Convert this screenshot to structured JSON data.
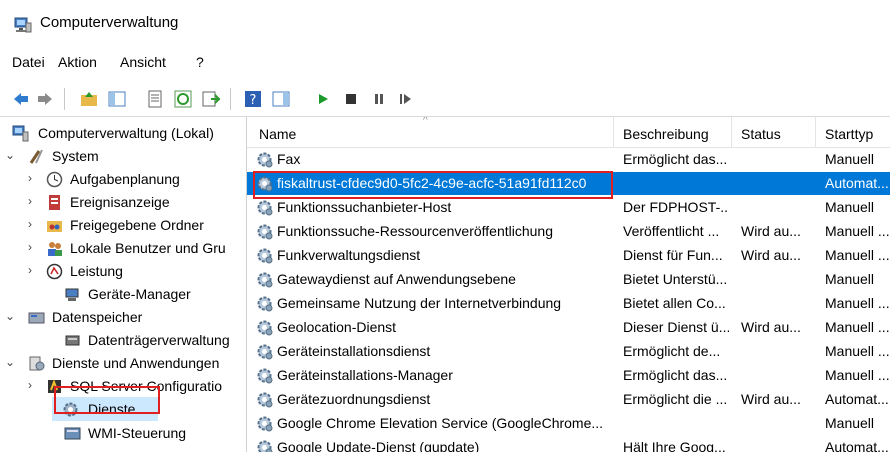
{
  "window": {
    "title": "Computerverwaltung"
  },
  "menu": {
    "items": [
      "Datei",
      "Aktion",
      "Ansicht",
      "?"
    ]
  },
  "tree": {
    "root": "Computerverwaltung (Lokal)",
    "system": "System",
    "aufgabenplanung": "Aufgabenplanung",
    "ereignisanzeige": "Ereignisanzeige",
    "freigegebene_ordner": "Freigegebene Ordner",
    "lokale_benutzer": "Lokale Benutzer und Gru",
    "leistung": "Leistung",
    "geraete_manager": "Geräte-Manager",
    "datenspeicher": "Datenspeicher",
    "datentraeger": "Datenträgerverwaltung",
    "dienste_anw": "Dienste und Anwendungen",
    "sql": "SQL Server Configuratio",
    "dienste": "Dienste",
    "wmi": "WMI-Steuerung"
  },
  "columns": {
    "name": "Name",
    "beschreibung": "Beschreibung",
    "status": "Status",
    "starttyp": "Starttyp"
  },
  "services": [
    {
      "name": "Fax",
      "beschreibung": "Ermöglicht das...",
      "status": "",
      "starttyp": "Manuell"
    },
    {
      "name": "fiskaltrust-cfdec9d0-5fc2-4c9e-acfc-51a91fd112c0",
      "beschreibung": "",
      "status": "",
      "starttyp": "Automat..."
    },
    {
      "name": "Funktionssuchanbieter-Host",
      "beschreibung": "Der FDPHOST-...",
      "status": "",
      "starttyp": "Manuell"
    },
    {
      "name": "Funktionssuche-Ressourcenveröffentlichung",
      "beschreibung": "Veröffentlicht ...",
      "status": "Wird au...",
      "starttyp": "Manuell ..."
    },
    {
      "name": "Funkverwaltungsdienst",
      "beschreibung": "Dienst für Fun...",
      "status": "Wird au...",
      "starttyp": "Manuell ..."
    },
    {
      "name": "Gatewaydienst auf Anwendungsebene",
      "beschreibung": "Bietet Unterstü...",
      "status": "",
      "starttyp": "Manuell"
    },
    {
      "name": "Gemeinsame Nutzung der Internetverbindung",
      "beschreibung": "Bietet allen Co...",
      "status": "",
      "starttyp": "Manuell ..."
    },
    {
      "name": "Geolocation-Dienst",
      "beschreibung": "Dieser Dienst ü...",
      "status": "Wird au...",
      "starttyp": "Manuell ..."
    },
    {
      "name": "Geräteinstallationsdienst",
      "beschreibung": "Ermöglicht de...",
      "status": "",
      "starttyp": "Manuell ..."
    },
    {
      "name": "Geräteinstallations-Manager",
      "beschreibung": "Ermöglicht das...",
      "status": "",
      "starttyp": "Manuell ..."
    },
    {
      "name": "Gerätezuordnungsdienst",
      "beschreibung": "Ermöglicht die ...",
      "status": "Wird au...",
      "starttyp": "Automat..."
    },
    {
      "name": "Google Chrome Elevation Service (GoogleChrome...",
      "beschreibung": "",
      "status": "",
      "starttyp": "Manuell"
    },
    {
      "name": "Google Update-Dienst (gupdate)",
      "beschreibung": "Hält Ihre Goog...",
      "status": "",
      "starttyp": "Automat..."
    }
  ],
  "colors": {
    "selection": "#0078d7",
    "highlight_box": "#e02020",
    "tree_selection": "#cce8ff"
  }
}
